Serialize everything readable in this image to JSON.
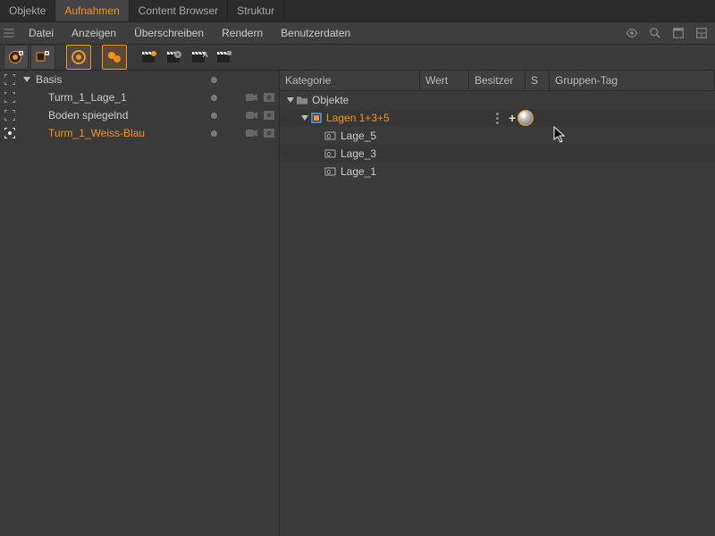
{
  "tabs": [
    "Objekte",
    "Aufnahmen",
    "Content Browser",
    "Struktur"
  ],
  "active_tab": 1,
  "menu": [
    "Datei",
    "Anzeigen",
    "Überschreiben",
    "Rendern",
    "Benutzerdaten"
  ],
  "left_tree": {
    "root": "Basis",
    "children": [
      {
        "name": "Turm_1_Lage_1",
        "selected": false
      },
      {
        "name": "Boden spiegelnd",
        "selected": false
      },
      {
        "name": "Turm_1_Weiss-Blau",
        "selected": true
      }
    ]
  },
  "right_cols": {
    "kat": "Kategorie",
    "wert": "Wert",
    "bes": "Besitzer",
    "s": "S",
    "tag": "Gruppen-Tag"
  },
  "right_rows": [
    {
      "indent": 0,
      "expander": true,
      "icon": "folder",
      "name": "Objekte",
      "orange": false,
      "s": false,
      "tag": false,
      "even": true
    },
    {
      "indent": 1,
      "expander": true,
      "icon": "layers-orange",
      "name": "Lagen 1+3+5",
      "orange": true,
      "s": true,
      "tag": true,
      "even": false
    },
    {
      "indent": 2,
      "expander": false,
      "icon": "layer",
      "name": "Lage_5",
      "orange": false,
      "s": false,
      "tag": false,
      "even": true
    },
    {
      "indent": 2,
      "expander": false,
      "icon": "layer",
      "name": "Lage_3",
      "orange": false,
      "s": false,
      "tag": false,
      "even": false
    },
    {
      "indent": 2,
      "expander": false,
      "icon": "layer",
      "name": "Lage_1",
      "orange": false,
      "s": false,
      "tag": false,
      "even": true
    }
  ]
}
